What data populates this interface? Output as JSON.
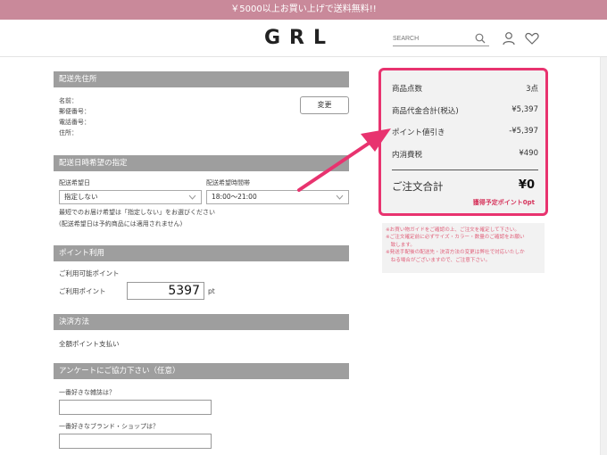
{
  "promo": {
    "text": "￥5000以上お買い上げで送料無料!!"
  },
  "header": {
    "logo": "GRL",
    "search_placeholder": "SEARCH"
  },
  "shipping": {
    "heading": "配送先住所",
    "name_label": "名前：",
    "zip_label": "郵便番号：",
    "phone_label": "電話番号：",
    "address_label": "住所：",
    "change_button": "変更"
  },
  "delivery": {
    "heading": "配送日時希望の指定",
    "date_label": "配送希望日",
    "date_value": "指定しない",
    "time_label": "配送希望時間帯",
    "time_value": "18:00～21:00",
    "note1": "最短でのお届け希望は「指定しない」をお選びください",
    "note2": "(配送希望日は予約商品には適用されません)"
  },
  "points": {
    "heading": "ポイント利用",
    "available_label": "ご利用可能ポイント",
    "use_label": "ご利用ポイント",
    "use_value": "5397",
    "unit": "pt"
  },
  "payment": {
    "heading": "決済方法",
    "method": "全額ポイント支払い"
  },
  "survey": {
    "heading": "アンケートにご協力下さい（任意）",
    "q1": "一番好きな雑誌は？",
    "q2": "一番好きなブランド・ショップは？"
  },
  "summary": {
    "item_count_label": "商品点数",
    "item_count_value": "3点",
    "subtotal_label": "商品代金合計(税込)",
    "subtotal_value": "¥5,397",
    "point_discount_label": "ポイント値引き",
    "point_discount_value": "-¥5,397",
    "shipping_label": "内消費税",
    "shipping_value": "¥490",
    "total_label": "ご注文合計",
    "total_value": "¥0",
    "earn_points": "獲得予定ポイント0pt"
  },
  "notes": [
    "※お買い物ガイドをご確認の上、ご注文を確定して下さい。",
    "※ご注文確定前に必ずサイズ・カラー・数量のご確認をお願い",
    "　致します。",
    "※発送手配後の配送先・決済方法の変更は弊社で対応いたしか",
    "　ねる場合がございますので、ご注意下さい。"
  ],
  "colors": {
    "promo_bar": "#c9899a",
    "section_header": "#9e9e9e",
    "highlight": "#e8336f",
    "note_text": "#e0607a"
  }
}
